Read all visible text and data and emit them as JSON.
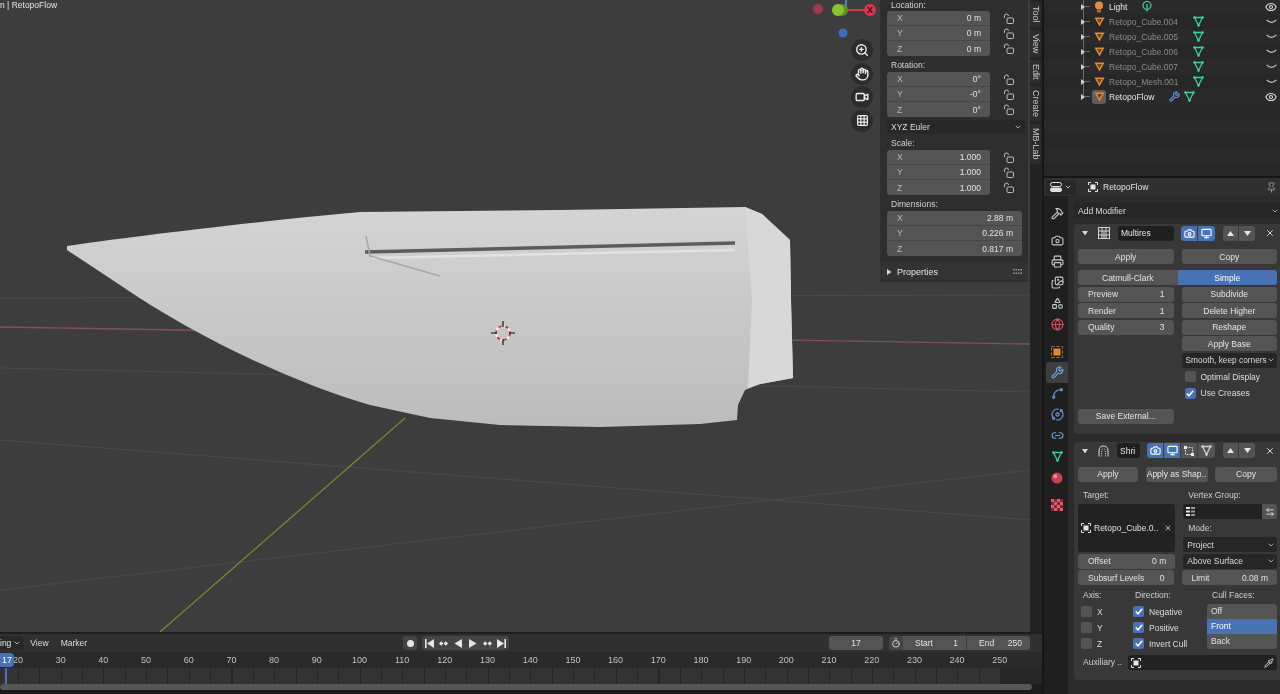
{
  "viewport": {
    "title": "n | RetopoFlow",
    "gizmo_label": "X"
  },
  "item_panel": {
    "groups": [
      {
        "kind": "transform",
        "label": "Location:",
        "fields": [
          {
            "axis": "X",
            "value": "0 m",
            "locked": false
          },
          {
            "axis": "Y",
            "value": "0 m",
            "locked": false
          },
          {
            "axis": "Z",
            "value": "0 m",
            "locked": false
          }
        ]
      },
      {
        "kind": "transform",
        "label": "Rotation:",
        "fields": [
          {
            "axis": "X",
            "value": "0°",
            "locked": false
          },
          {
            "axis": "Y",
            "value": "-0°",
            "locked": false
          },
          {
            "axis": "Z",
            "value": "0°",
            "locked": false
          }
        ]
      },
      {
        "kind": "dropdown",
        "value": "XYZ Euler"
      },
      {
        "kind": "transform",
        "label": "Scale:",
        "fields": [
          {
            "axis": "X",
            "value": "1.000",
            "locked": false
          },
          {
            "axis": "Y",
            "value": "1.000",
            "locked": false
          },
          {
            "axis": "Z",
            "value": "1.000",
            "locked": false
          }
        ]
      },
      {
        "kind": "dimensions",
        "label": "Dimensions:",
        "fields": [
          {
            "axis": "X",
            "value": "2.88 m"
          },
          {
            "axis": "Y",
            "value": "0.226 m"
          },
          {
            "axis": "Z",
            "value": "0.817 m"
          }
        ]
      }
    ],
    "subpanel": {
      "label": "Properties",
      "expanded": false
    }
  },
  "sidebar_tabs": [
    {
      "label": "Tool",
      "selected": false
    },
    {
      "label": "View",
      "selected": false
    },
    {
      "label": "Edit",
      "selected": false
    },
    {
      "label": "Create",
      "selected": false
    },
    {
      "label": "MB-Lab",
      "selected": false
    }
  ],
  "outliner": {
    "rows": [
      {
        "kind": "light",
        "name": "Light",
        "visible": true,
        "active": false,
        "has_modifier": false
      },
      {
        "kind": "mesh",
        "name": "Retopo_Cube.004",
        "visible": false,
        "active": false,
        "has_modifier": false
      },
      {
        "kind": "mesh",
        "name": "Retopo_Cube.005",
        "visible": false,
        "active": false,
        "has_modifier": false
      },
      {
        "kind": "mesh",
        "name": "Retopo_Cube.006",
        "visible": false,
        "active": false,
        "has_modifier": false
      },
      {
        "kind": "mesh",
        "name": "Retopo_Cube.007",
        "visible": false,
        "active": false,
        "has_modifier": false
      },
      {
        "kind": "mesh",
        "name": "Retopo_Mesh.001",
        "visible": false,
        "active": false,
        "has_modifier": false
      },
      {
        "kind": "mesh",
        "name": "RetopoFlow",
        "visible": true,
        "active": true,
        "has_modifier": true
      }
    ]
  },
  "properties": {
    "object_name": "RetopoFlow",
    "tab_groups": [
      {
        "tabs": [
          {
            "kind": "tool",
            "selected": false
          }
        ]
      },
      {
        "tabs": [
          {
            "kind": "render",
            "selected": false
          },
          {
            "kind": "output",
            "selected": false
          },
          {
            "kind": "view_layer",
            "selected": false
          },
          {
            "kind": "scene",
            "selected": false
          },
          {
            "kind": "world",
            "selected": false
          }
        ]
      },
      {
        "tabs": [
          {
            "kind": "object",
            "selected": false
          },
          {
            "kind": "modifiers",
            "selected": true
          },
          {
            "kind": "particles",
            "selected": false
          },
          {
            "kind": "physics",
            "selected": false
          },
          {
            "kind": "constraints",
            "selected": false
          },
          {
            "kind": "data",
            "selected": false
          },
          {
            "kind": "material",
            "selected": false
          }
        ]
      },
      {
        "tabs": [
          {
            "kind": "texture",
            "selected": false
          }
        ]
      }
    ],
    "add_modifier": "Add Modifier",
    "modifiers": [
      {
        "kind": "multires",
        "name": "Multires",
        "expanded": true,
        "toggles": [
          {
            "kind": "render",
            "on": true
          },
          {
            "kind": "viewport",
            "on": true
          }
        ],
        "actions": [
          "Apply",
          "Copy"
        ],
        "subdivision_types": [
          {
            "label": "Catmull-Clark",
            "selected": false
          },
          {
            "label": "Simple",
            "selected": true
          }
        ],
        "levels": [
          {
            "label": "Preview",
            "value": "1"
          },
          {
            "label": "Render",
            "value": "1"
          },
          {
            "label": "Quality",
            "value": "3"
          }
        ],
        "operations": [
          "Subdivide",
          "Delete Higher",
          "Reshape",
          "Apply Base"
        ],
        "uv_smooth": "Smooth, keep corners",
        "options": [
          {
            "label": "Optimal Display",
            "checked": false
          },
          {
            "label": "Use Creases",
            "checked": true
          }
        ],
        "save_external": "Save External..."
      },
      {
        "kind": "shrinkwrap",
        "name": "Shri",
        "expanded": true,
        "toggles": [
          {
            "kind": "render",
            "on": true
          },
          {
            "kind": "viewport",
            "on": true
          },
          {
            "kind": "editmode",
            "on": false
          },
          {
            "kind": "cage",
            "on": false
          }
        ],
        "actions": [
          "Apply",
          "Apply as Shap..",
          "Copy"
        ],
        "target_label": "Target:",
        "target": "Retopo_Cube.0..",
        "vertex_group_label": "Vertex Group:",
        "offset": {
          "label": "Offset",
          "value": "0 m"
        },
        "mode_label": "Mode:",
        "wrap_method": "Project",
        "snap_mode": "Above Surface",
        "subsurf_levels": {
          "label": "Subsurf Levels",
          "value": "0"
        },
        "limit": {
          "label": "Limit",
          "value": "0.08 m"
        },
        "axis_label": "Axis:",
        "axes": [
          {
            "label": "X",
            "checked": false
          },
          {
            "label": "Y",
            "checked": false
          },
          {
            "label": "Z",
            "checked": false
          }
        ],
        "direction_label": "Direction:",
        "directions": [
          {
            "label": "Negative",
            "checked": true
          },
          {
            "label": "Positive",
            "checked": true
          },
          {
            "label": "Invert Cull",
            "checked": true
          }
        ],
        "cull_label": "Cull Faces:",
        "cull_faces": [
          {
            "label": "Off",
            "selected": false
          },
          {
            "label": "Front",
            "selected": true
          },
          {
            "label": "Back",
            "selected": false
          }
        ],
        "auxiliary_label": "Auxiliary .."
      }
    ]
  },
  "timeline": {
    "mode_menu": "ing",
    "menus": [
      "View",
      "Marker"
    ],
    "auto_keying": false,
    "current_frame": "17",
    "start": {
      "label": "Start",
      "value": "1"
    },
    "end": {
      "label": "End",
      "value": "250"
    },
    "playhead_label": "17",
    "ticks": [
      "20",
      "30",
      "40",
      "50",
      "60",
      "70",
      "80",
      "90",
      "100",
      "110",
      "120",
      "130",
      "140",
      "150",
      "160",
      "170",
      "180",
      "190",
      "200",
      "210",
      "220",
      "230",
      "240",
      "250"
    ]
  }
}
